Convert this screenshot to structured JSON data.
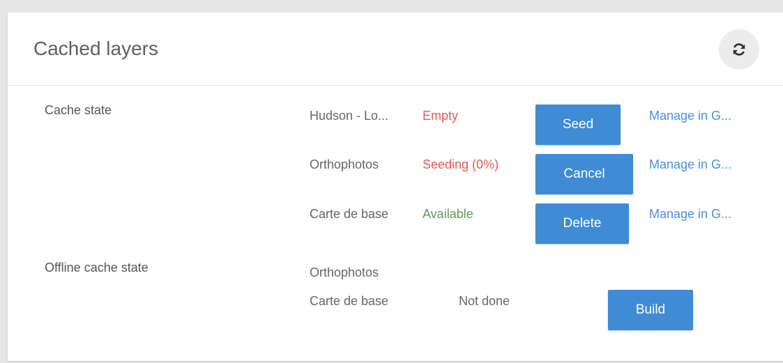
{
  "card": {
    "title": "Cached layers",
    "refresh_icon": "refresh-icon"
  },
  "cache_state": {
    "label": "Cache state",
    "rows": [
      {
        "layer": "Hudson - Lo...",
        "status": "Empty",
        "action": "Seed",
        "link": "Manage in G..."
      },
      {
        "layer": "Orthophotos",
        "status": "Seeding (0%)",
        "action": "Cancel",
        "link": "Manage in G..."
      },
      {
        "layer": "Carte de base",
        "status": "Available",
        "action": "Delete",
        "link": "Manage in G..."
      }
    ]
  },
  "offline_cache_state": {
    "label": "Offline cache state",
    "layers": [
      "Orthophotos",
      "Carte de base"
    ],
    "status": "Not done",
    "action": "Build"
  },
  "colors": {
    "accent": "#3f8bd6",
    "status_red": "#e8584f",
    "status_green": "#5b9a5b",
    "link": "#4a90e2"
  }
}
